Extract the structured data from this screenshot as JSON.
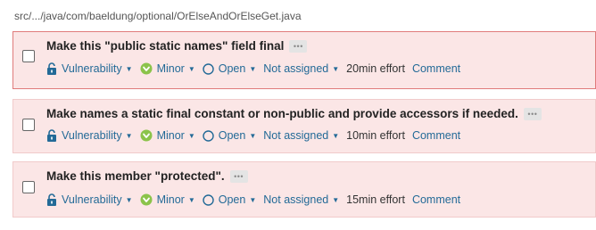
{
  "file": {
    "path": "src/.../java/com/baeldung/optional/OrElseAndOrElseGet.java"
  },
  "colors": {
    "issue_background": "#fbe6e6",
    "selected_border": "#e07b7b",
    "link": "#236a97",
    "vulnerability_icon": "#236a97",
    "minor_icon": "#8bc34a"
  },
  "issues": [
    {
      "title": "Make this \"public static names\" field final",
      "more": "•••",
      "type": "Vulnerability",
      "type_icon": "lock-open-icon",
      "severity": "Minor",
      "severity_icon": "minor-severity-icon",
      "status": "Open",
      "status_icon": "circle-open-icon",
      "assignee": "Not assigned",
      "effort": "20min effort",
      "comment": "Comment"
    },
    {
      "title": "Make names a static final constant or non-public and provide accessors if needed.",
      "more": "•••",
      "type": "Vulnerability",
      "type_icon": "lock-open-icon",
      "severity": "Minor",
      "severity_icon": "minor-severity-icon",
      "status": "Open",
      "status_icon": "circle-open-icon",
      "assignee": "Not assigned",
      "effort": "10min effort",
      "comment": "Comment"
    },
    {
      "title": "Make this member \"protected\".",
      "more": "•••",
      "type": "Vulnerability",
      "type_icon": "lock-open-icon",
      "severity": "Minor",
      "severity_icon": "minor-severity-icon",
      "status": "Open",
      "status_icon": "circle-open-icon",
      "assignee": "Not assigned",
      "effort": "15min effort",
      "comment": "Comment"
    }
  ]
}
